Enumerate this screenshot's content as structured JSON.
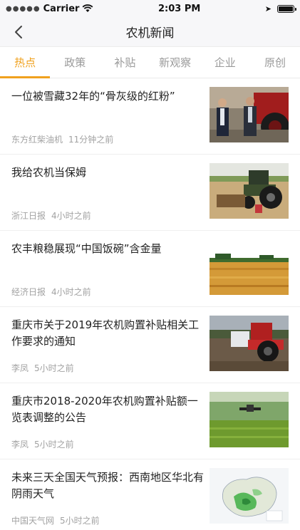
{
  "status_bar": {
    "carrier": "Carrier",
    "time": "2:03 PM"
  },
  "nav": {
    "title": "农机新闻",
    "back_icon": "chevron-left-icon"
  },
  "tabs": [
    {
      "label": "热点",
      "active": true
    },
    {
      "label": "政策",
      "active": false
    },
    {
      "label": "补贴",
      "active": false
    },
    {
      "label": "新观察",
      "active": false
    },
    {
      "label": "企业",
      "active": false
    },
    {
      "label": "原创",
      "active": false
    }
  ],
  "accent_color": "#f0a11e",
  "news": [
    {
      "title": "一位被雪藏32年的“骨灰级的红粉”",
      "source": "东方红柴油机",
      "time": "11分钟之前"
    },
    {
      "title": "我给农机当保姆",
      "source": "浙江日报",
      "time": "4小时之前"
    },
    {
      "title": "农丰粮稳展现“中国饭碗”含金量",
      "source": "经济日报",
      "time": "4小时之前"
    },
    {
      "title": "重庆市关于2019年农机购置补贴相关工作要求的通知",
      "source": "李凤",
      "time": "5小时之前"
    },
    {
      "title": "重庆市2018-2020年农机购置补贴额一览表调整的公告",
      "source": "李凤",
      "time": "5小时之前"
    },
    {
      "title": "未来三天全国天气预报：西南地区华北有阴雨天气",
      "source": "中国天气网",
      "time": "5小时之前"
    }
  ]
}
